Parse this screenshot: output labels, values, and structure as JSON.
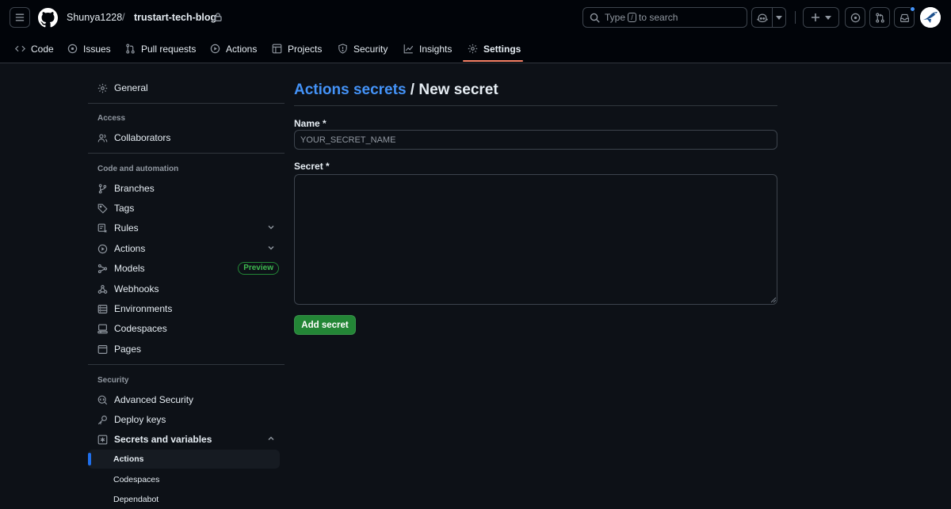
{
  "header": {
    "owner": "Shunya1228",
    "separator": "/",
    "repo": "trustart-tech-blog",
    "search": {
      "prefix": "Type",
      "key": "/",
      "suffix": "to search"
    },
    "icons": [
      "menu-icon",
      "github-logo-icon",
      "lock-icon",
      "search-icon",
      "copilot-icon",
      "plus-icon",
      "issue-opened-icon",
      "pull-request-icon",
      "inbox-icon"
    ],
    "notification_color": "#4493f8"
  },
  "repo_nav": {
    "tabs": [
      {
        "label": "Code",
        "icon": "code-icon"
      },
      {
        "label": "Issues",
        "icon": "issue-icon"
      },
      {
        "label": "Pull requests",
        "icon": "pull-request-icon"
      },
      {
        "label": "Actions",
        "icon": "play-icon"
      },
      {
        "label": "Projects",
        "icon": "table-icon"
      },
      {
        "label": "Security",
        "icon": "shield-icon"
      },
      {
        "label": "Insights",
        "icon": "graph-icon"
      },
      {
        "label": "Settings",
        "icon": "gear-icon",
        "selected": true
      }
    ],
    "selected_underline_color": "#f78166"
  },
  "sidebar": {
    "general": "General",
    "access_heading": "Access",
    "collaborators": "Collaborators",
    "code_heading": "Code and automation",
    "branches": "Branches",
    "tags": "Tags",
    "rules": "Rules",
    "actions": "Actions",
    "models": "Models",
    "models_badge": "Preview",
    "webhooks": "Webhooks",
    "environments": "Environments",
    "codespaces": "Codespaces",
    "pages": "Pages",
    "security_heading": "Security",
    "advanced_security": "Advanced Security",
    "deploy_keys": "Deploy keys",
    "secrets_and_variables": "Secrets and variables",
    "sub_actions": "Actions",
    "sub_codespaces": "Codespaces",
    "sub_dependabot": "Dependabot"
  },
  "main": {
    "breadcrumb_link": "Actions secrets",
    "breadcrumb_rest": " / New secret",
    "name_label": "Name *",
    "name_value": "",
    "name_placeholder": "YOUR_SECRET_NAME",
    "secret_label": "Secret *",
    "secret_value": "",
    "add_button": "Add secret"
  },
  "colors": {
    "accent_link": "#4493f8",
    "primary_button": "#238636",
    "preview_badge": "#3fb950",
    "active_item_bar": "#1f6feb"
  }
}
